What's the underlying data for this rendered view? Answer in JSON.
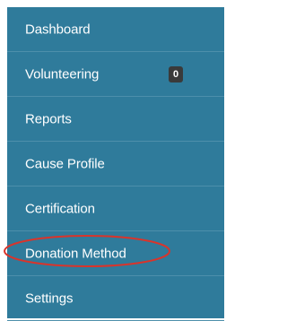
{
  "sidebar": {
    "items": [
      {
        "label": "Dashboard"
      },
      {
        "label": "Volunteering",
        "badge": "0"
      },
      {
        "label": "Reports"
      },
      {
        "label": "Cause Profile"
      },
      {
        "label": "Certification"
      },
      {
        "label": "Donation Method",
        "highlighted": true
      },
      {
        "label": "Settings"
      }
    ]
  },
  "colors": {
    "sidebar_bg": "#2f7b9b",
    "divider": "#4d8fab",
    "badge_bg": "#3a3a3a",
    "annotation": "#d9342b"
  }
}
